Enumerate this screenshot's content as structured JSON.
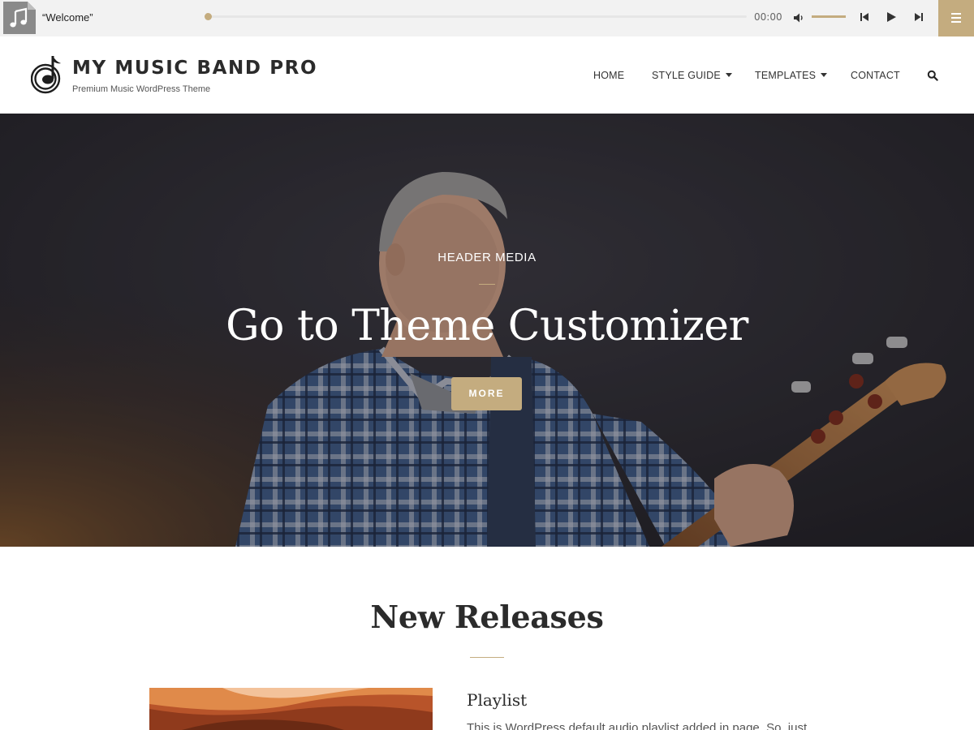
{
  "player": {
    "track_title": "“Welcome”",
    "time": "00:00",
    "progress": 0,
    "volume": 1.0,
    "icons": {
      "thumbnail": "music-note-icon",
      "volume": "volume-icon",
      "previous": "skip-previous-icon",
      "play": "play-icon",
      "next": "skip-next-icon",
      "menu": "hamburger-menu-icon"
    }
  },
  "header": {
    "site_title": "MY MUSIC BAND PRO",
    "site_description": "Premium Music WordPress Theme",
    "logo_icon": "music-note-disc-icon",
    "nav": [
      {
        "label": "HOME"
      },
      {
        "label": "STYLE GUIDE",
        "has_dropdown": true
      },
      {
        "label": "TEMPLATES",
        "has_dropdown": true
      },
      {
        "label": "CONTACT"
      }
    ],
    "search_icon": "search-icon"
  },
  "hero": {
    "label": "HEADER MEDIA",
    "title": "Go to Theme Customizer",
    "button_label": "MORE"
  },
  "releases": {
    "title": "New Releases",
    "items": [
      {
        "title": "Playlist",
        "excerpt": "This is WordPress default audio playlist added in page. So, just"
      }
    ]
  },
  "colors": {
    "accent": "#c4ac7f",
    "player_bg": "#f2f2f2",
    "text": "#2b2b2b"
  }
}
